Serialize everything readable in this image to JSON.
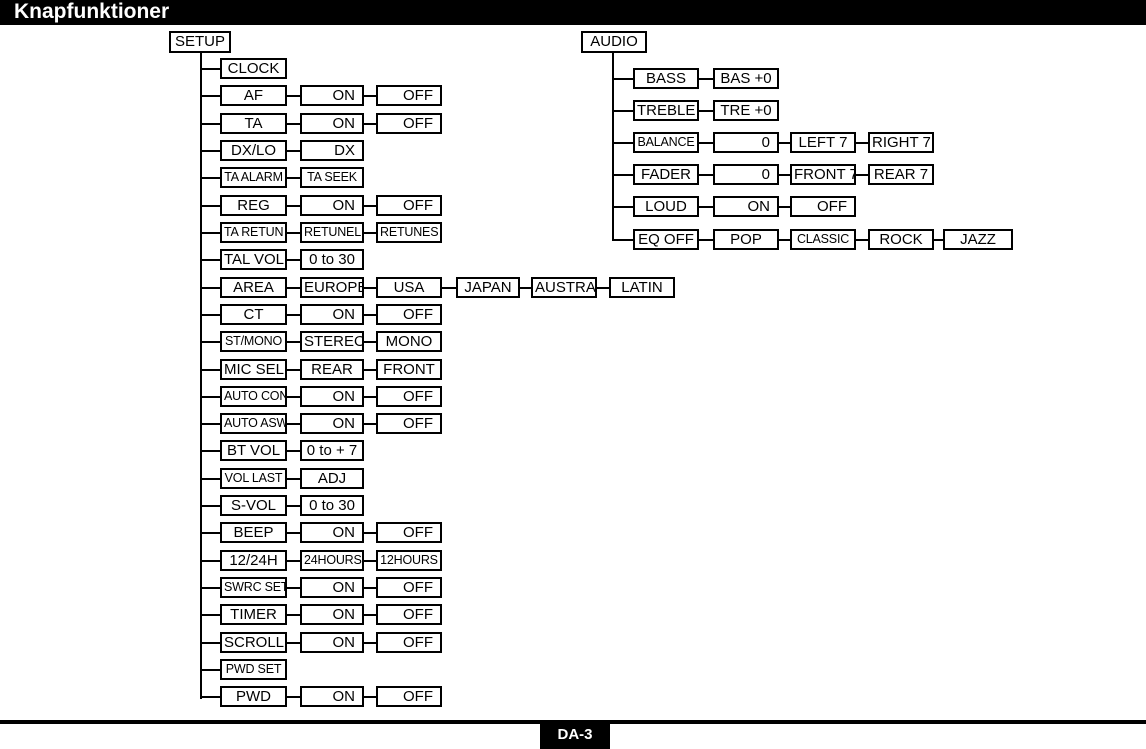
{
  "header": {
    "title": "Knapfunktioner"
  },
  "footer": {
    "page_label": "DA-3"
  },
  "colors": {
    "ink": "#000000",
    "paper": "#ffffff"
  },
  "diagram": {
    "type": "tree",
    "trees": [
      {
        "id": "setup",
        "root": "SETUP",
        "rows": [
          {
            "label": "CLOCK",
            "values": []
          },
          {
            "label": "AF",
            "values": [
              "ON",
              "OFF"
            ]
          },
          {
            "label": "TA",
            "values": [
              "ON",
              "OFF"
            ]
          },
          {
            "label": "DX/LO",
            "values": [
              "DX"
            ]
          },
          {
            "label": "TA ALARM",
            "values": [
              "TA SEEK"
            ]
          },
          {
            "label": "REG",
            "values": [
              "ON",
              "OFF"
            ]
          },
          {
            "label": "TA RETUN",
            "values": [
              "RETUNEL",
              "RETUNES"
            ]
          },
          {
            "label": "TAL VOL",
            "values": [
              "0 to 30"
            ]
          },
          {
            "label": "AREA",
            "values": [
              "EUROPE",
              "USA",
              "JAPAN",
              "AUSTRA",
              "LATIN"
            ]
          },
          {
            "label": "CT",
            "values": [
              "ON",
              "OFF"
            ]
          },
          {
            "label": "ST/MONO",
            "values": [
              "STEREO",
              "MONO"
            ]
          },
          {
            "label": "MIC SEL",
            "values": [
              "REAR",
              "FRONT"
            ]
          },
          {
            "label": "AUTO CON",
            "values": [
              "ON",
              "OFF"
            ]
          },
          {
            "label": "AUTO ASW",
            "values": [
              "ON",
              "OFF"
            ]
          },
          {
            "label": "BT VOL",
            "values": [
              "0 to + 7"
            ]
          },
          {
            "label": "VOL LAST",
            "values": [
              "ADJ"
            ]
          },
          {
            "label": "S-VOL",
            "values": [
              "0 to 30"
            ]
          },
          {
            "label": "BEEP",
            "values": [
              "ON",
              "OFF"
            ]
          },
          {
            "label": "12/24H",
            "values": [
              "24HOURS",
              "12HOURS"
            ]
          },
          {
            "label": "SWRC SET",
            "values": [
              "ON",
              "OFF"
            ]
          },
          {
            "label": "TIMER",
            "values": [
              "ON",
              "OFF"
            ]
          },
          {
            "label": "SCROLL",
            "values": [
              "ON",
              "OFF"
            ]
          },
          {
            "label": "PWD SET",
            "values": []
          },
          {
            "label": "PWD",
            "values": [
              "ON",
              "OFF"
            ]
          }
        ]
      },
      {
        "id": "audio",
        "root": "AUDIO",
        "rows": [
          {
            "label": "BASS",
            "values": [
              "BAS +0"
            ]
          },
          {
            "label": "TREBLE",
            "values": [
              "TRE +0"
            ]
          },
          {
            "label": "BALANCE",
            "values": [
              "0",
              "LEFT 7",
              "RIGHT 7"
            ]
          },
          {
            "label": "FADER",
            "values": [
              "0",
              "FRONT 7",
              "REAR 7"
            ]
          },
          {
            "label": "LOUD",
            "values": [
              "ON",
              "OFF"
            ]
          },
          {
            "label": "EQ OFF",
            "values": [
              "POP",
              "CLASSIC",
              "ROCK",
              "JAZZ"
            ]
          }
        ]
      }
    ]
  }
}
